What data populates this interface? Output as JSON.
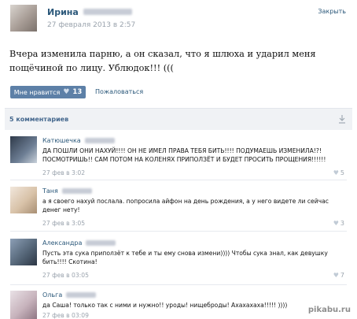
{
  "post": {
    "author_name": "Ирина",
    "date": "27 февраля 2013 в 2:57",
    "close_label": "Закрыть",
    "text": "Вчера изменила парню, а он сказал, что я шлюха и ударил меня пощёчиной по лицу. Ублюдок!!! (((",
    "like_label": "Мне нравится",
    "like_count": "13",
    "share_label": "Пожаловаться"
  },
  "comments_header": {
    "title": "5 комментариев"
  },
  "comments": [
    {
      "name": "Катюшечка",
      "text": "ДА ПОШЛИ ОНИ НАХУЙ!!!! ОН НЕ ИМЕЛ ПРАВА ТЕБЯ БИТЬ!!!! ПОДУМАЕШЬ ИЗМЕНИЛА!?! ПОСМОТРИШЬ!! САМ ПОТОМ НА КОЛЕНЯХ ПРИПОЛЗЁТ И БУДЕТ ПРОСИТЬ ПРОЩЕНИЯ!!!!!!",
      "date": "27 фев в 3:02",
      "likes": "5"
    },
    {
      "name": "Таня",
      "text": "а я своего нахуй послала. попросила айфон на день рождения, а у него видете ли сейчас денег нету!",
      "date": "27 фев в 3:05",
      "likes": "3"
    },
    {
      "name": "Александра",
      "text": "Пусть эта сука приползёт к тебе и ты ему снова измени)))) Чтобы сука знал, как девушку бить!!!! Скотина!",
      "date": "27 фев в 03:05",
      "likes": "7"
    },
    {
      "name": "Ольга",
      "text": "да Саша! только так с ними и нужно!! уроды! нищеброды! Ахахахаха!!!!! ))))",
      "date": "27 фев в 03:09",
      "likes": ""
    }
  ],
  "watermark": "pikabu.ru",
  "icons": {
    "heart": "♥",
    "collapse": "collapse-icon"
  },
  "colors": {
    "link": "#2b587a",
    "button": "#5d80a7",
    "muted": "#9aa3ad",
    "bar": "#f0f2f5"
  }
}
